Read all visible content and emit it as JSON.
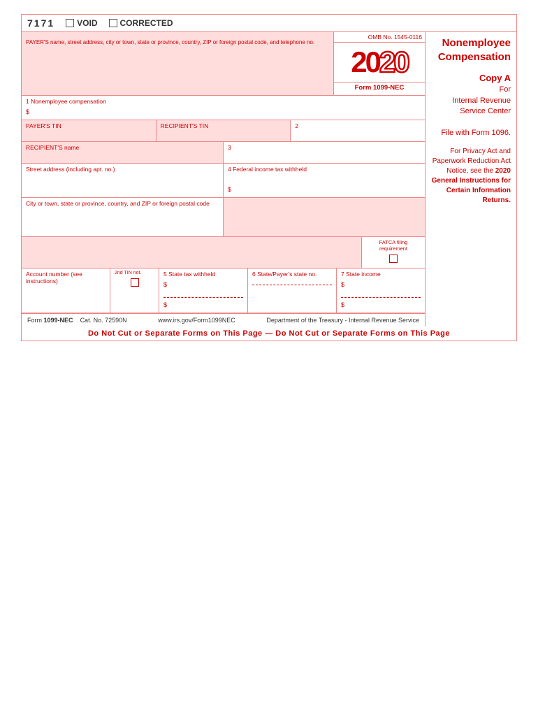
{
  "form": {
    "number_display": "7171",
    "void_label": "VOID",
    "corrected_label": "CORRECTED",
    "omb_number": "OMB No. 1545-0116",
    "year": {
      "solid": "20",
      "outline": "20"
    },
    "form_name": "Form  1099-NEC",
    "title": "Nonemployee\nCompensation",
    "copy_section": {
      "copy": "Copy A",
      "for": "For",
      "line1": "Internal Revenue",
      "line2": "Service Center",
      "file_with": "File with Form 1096."
    },
    "privacy_text": "For Privacy Act and Paperwork Reduction Act Notice, see the 2020 General Instructions for Certain Information Returns.",
    "fields": {
      "payer_label": "PAYER'S name, street address, city or town, state or province, country, ZIP or foreign postal code, and telephone no.",
      "box1_label": "1  Nonemployee compensation",
      "box1_dollar": "$",
      "box2_label": "2",
      "payer_tin_label": "PAYER'S TIN",
      "recipient_tin_label": "RECIPIENT'S TIN",
      "recipient_name_label": "RECIPIENT'S name",
      "box3_label": "3",
      "street_label": "Street address (including apt. no.)",
      "box4_label": "4  Federal income tax withheld",
      "box4_dollar": "$",
      "city_label": "City or town, state or province, country, and ZIP or foreign postal code",
      "fatca_label": "FATCA filing requirement",
      "account_label": "Account number (see instructions)",
      "tin_2nd_label": "2nd TIN not.",
      "box5_label": "5  State tax withheld",
      "box5_dollar1": "$",
      "box5_dollar2": "$",
      "box6_label": "6  State/Payer's state no.",
      "box7_label": "7  State income",
      "box7_dollar1": "$",
      "box7_dollar2": "$"
    },
    "footer": {
      "form_label": "Form",
      "form_number": "1099-NEC",
      "cat_label": "Cat. No. 72590N",
      "url": "www.irs.gov/Form1099NEC",
      "dept": "Department of the Treasury - Internal Revenue Service"
    },
    "bottom_text": "Do Not Cut or Separate Forms on This Page  —  Do Not Cut or Separate Forms on This Page"
  }
}
